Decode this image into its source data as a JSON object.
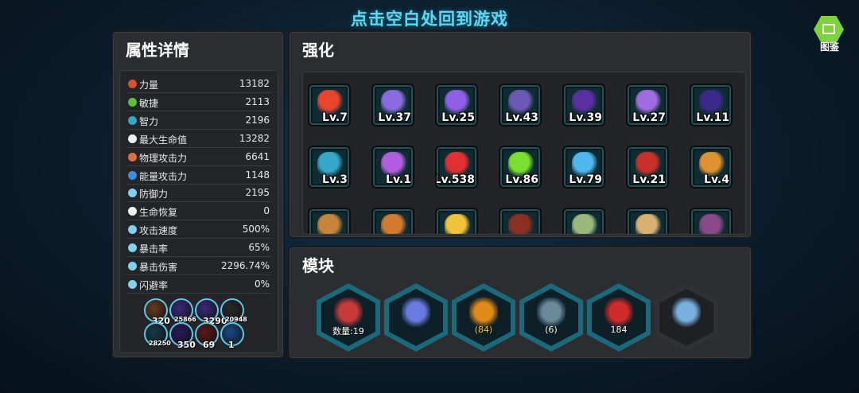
{
  "hint": "点击空白处回到游戏",
  "codex": {
    "label": "图鉴",
    "icon": "book-icon"
  },
  "attributes": {
    "title": "属性详情",
    "rows": [
      {
        "name": "力量",
        "value": "13182",
        "icon": "strength-icon",
        "color": "#d9502f"
      },
      {
        "name": "敏捷",
        "value": "2113",
        "icon": "agility-icon",
        "color": "#5fbf3a"
      },
      {
        "name": "智力",
        "value": "2196",
        "icon": "intelligence-icon",
        "color": "#36a6c9"
      },
      {
        "name": "最大生命值",
        "value": "13282",
        "icon": "heart-icon",
        "color": "#f2f2f2"
      },
      {
        "name": "物理攻击力",
        "value": "6641",
        "icon": "physical-attack-icon",
        "color": "#e0703a"
      },
      {
        "name": "能量攻击力",
        "value": "1148",
        "icon": "energy-attack-icon",
        "color": "#3c8ce0"
      },
      {
        "name": "防御力",
        "value": "2195",
        "icon": "shield-icon",
        "color": "#7fd3f0"
      },
      {
        "name": "生命恢复",
        "value": "0",
        "icon": "heart-regen-icon",
        "color": "#f2f2f2"
      },
      {
        "name": "攻击速度",
        "value": "500%",
        "icon": "attack-speed-icon",
        "color": "#7fd3f0"
      },
      {
        "name": "暴击率",
        "value": "65%",
        "icon": "crit-rate-icon",
        "color": "#7fd3f0"
      },
      {
        "name": "暴击伤害",
        "value": "2296.74%",
        "icon": "crit-damage-icon",
        "color": "#7fd3f0"
      },
      {
        "name": "闪避率",
        "value": "0%",
        "icon": "dodge-icon",
        "color": "#7fd3f0"
      }
    ],
    "buffs": [
      {
        "icon": "burger-icon",
        "value": "320"
      },
      {
        "icon": "speed-dial-icon",
        "value": "25866"
      },
      {
        "icon": "double-arrow-icon",
        "value": "3290"
      },
      {
        "icon": "arrow-icon",
        "value": "20948"
      },
      {
        "icon": "gauge-icon",
        "value": "28250"
      },
      {
        "icon": "up-arrows-icon",
        "value": "350"
      },
      {
        "icon": "red-swirl-icon",
        "value": "69"
      },
      {
        "icon": "blue-shield-icon",
        "value": "1"
      }
    ]
  },
  "upgrades": {
    "title": "强化",
    "items": [
      {
        "icon": "fire-heart-icon",
        "level": "Lv.7",
        "color": "#e8452c"
      },
      {
        "icon": "axe-icon",
        "level": "Lv.37",
        "color": "#8a6be0"
      },
      {
        "icon": "purple-dagger-icon",
        "level": "Lv.25",
        "color": "#8f5fe6"
      },
      {
        "icon": "gun-staff-icon",
        "level": "Lv.43",
        "color": "#6b5ab3"
      },
      {
        "icon": "purple-cube-icon",
        "level": "Lv.39",
        "color": "#5a2fa0"
      },
      {
        "icon": "brain-jar-icon",
        "level": "Lv.27",
        "color": "#a06be0"
      },
      {
        "icon": "hooded-figure-icon",
        "level": "Lv.11",
        "color": "#3b2a8a"
      },
      {
        "icon": "blue-ticket-icon",
        "level": "Lv.3",
        "color": "#35a7c9"
      },
      {
        "icon": "purple-ticket-icon",
        "level": "Lv.1",
        "color": "#b35ee0"
      },
      {
        "icon": "red-gem-icon",
        "level": "Lv.538",
        "color": "#e0302f"
      },
      {
        "icon": "green-gem-icon",
        "level": "Lv.86",
        "color": "#7ae02f"
      },
      {
        "icon": "blue-crystal-icon",
        "level": "Lv.79",
        "color": "#4fb6f0"
      },
      {
        "icon": "red-ore-icon",
        "level": "Lv.21",
        "color": "#c8302a"
      },
      {
        "icon": "pizza-icon",
        "level": "Lv.4",
        "color": "#e0922f"
      },
      {
        "icon": "burger-icon",
        "level": "",
        "color": "#c8853a"
      },
      {
        "icon": "fried-chicken-icon",
        "level": "",
        "color": "#d27a2f"
      },
      {
        "icon": "fries-icon",
        "level": "",
        "color": "#f2c23a"
      },
      {
        "icon": "cola-bottle-icon",
        "level": "",
        "color": "#8a3020"
      },
      {
        "icon": "salad-bowl-icon",
        "level": "",
        "color": "#9ab87a"
      },
      {
        "icon": "dumpling-plate-icon",
        "level": "",
        "color": "#d8b070"
      },
      {
        "icon": "cake-plate-icon",
        "level": "",
        "color": "#8a4a8a"
      }
    ]
  },
  "modules": {
    "title": "模块",
    "items": [
      {
        "icon": "syringe-icon",
        "text": "数量:19",
        "highlight": false
      },
      {
        "icon": "scythe-weapon-icon",
        "text": "",
        "highlight": false
      },
      {
        "icon": "fire-eye-icon",
        "text": "(84)",
        "highlight": true
      },
      {
        "icon": "rifle-icon",
        "text": "(6)",
        "highlight": false
      },
      {
        "icon": "red-scythe-icon",
        "text": "184",
        "highlight": false
      },
      {
        "icon": "mirror-frame-icon",
        "text": "",
        "highlight": false
      }
    ]
  }
}
